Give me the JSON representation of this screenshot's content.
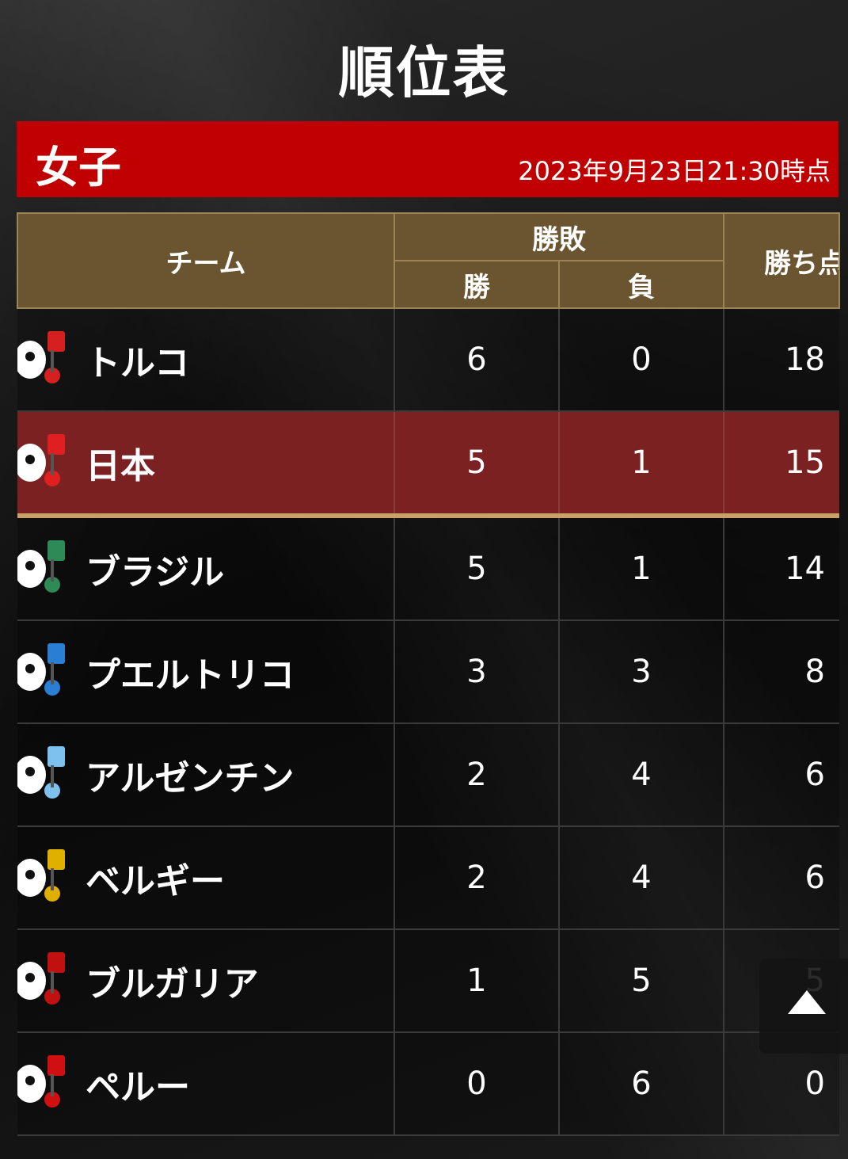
{
  "title": "順位表",
  "section": {
    "label": "女子",
    "timestamp": "2023年9月23日21:30時点"
  },
  "table": {
    "headers": {
      "team": "チーム",
      "record": "勝敗",
      "wins": "勝",
      "losses": "負",
      "points": "勝ち点"
    },
    "rows": [
      {
        "team": "トルコ",
        "wins": "6",
        "losses": "0",
        "points": "18",
        "mascot_color": "#d62020"
      },
      {
        "team": "日本",
        "wins": "5",
        "losses": "1",
        "points": "15",
        "mascot_color": "#e02020",
        "highlight": true
      },
      {
        "team": "ブラジル",
        "wins": "5",
        "losses": "1",
        "points": "14",
        "mascot_color": "#2e8b57"
      },
      {
        "team": "プエルトリコ",
        "wins": "3",
        "losses": "3",
        "points": "8",
        "mascot_color": "#2a7fd4"
      },
      {
        "team": "アルゼンチン",
        "wins": "2",
        "losses": "4",
        "points": "6",
        "mascot_color": "#7ec0ee"
      },
      {
        "team": "ベルギー",
        "wins": "2",
        "losses": "4",
        "points": "6",
        "mascot_color": "#e0b000"
      },
      {
        "team": "ブルガリア",
        "wins": "1",
        "losses": "5",
        "points": "5",
        "mascot_color": "#c01010"
      },
      {
        "team": "ペルー",
        "wins": "0",
        "losses": "6",
        "points": "0",
        "mascot_color": "#d01010"
      }
    ]
  },
  "colors": {
    "banner": "#c00000",
    "header_bg": "#6b5530",
    "highlight_row": "#7c2122"
  },
  "scroll_top_icon": "arrow-up-icon"
}
